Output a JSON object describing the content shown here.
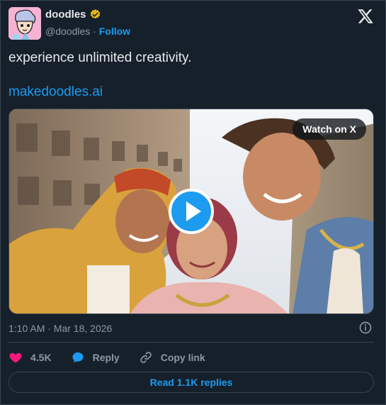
{
  "header": {
    "display_name": "doodles",
    "handle": "@doodles",
    "separator": "·",
    "follow_label": "Follow"
  },
  "tweet": {
    "text": "experience unlimited creativity.",
    "link": "makedoodles.ai"
  },
  "media": {
    "watch_label": "Watch on X"
  },
  "meta": {
    "timestamp": "1:10 AM · Mar 18, 2026"
  },
  "actions": {
    "likes": "4.5K",
    "reply_label": "Reply",
    "copy_label": "Copy link"
  },
  "footer": {
    "read_replies_label": "Read 1.1K replies"
  },
  "colors": {
    "background": "#15202b",
    "accent": "#1d9bf0",
    "like": "#f91880",
    "verified": "#e2b719"
  }
}
